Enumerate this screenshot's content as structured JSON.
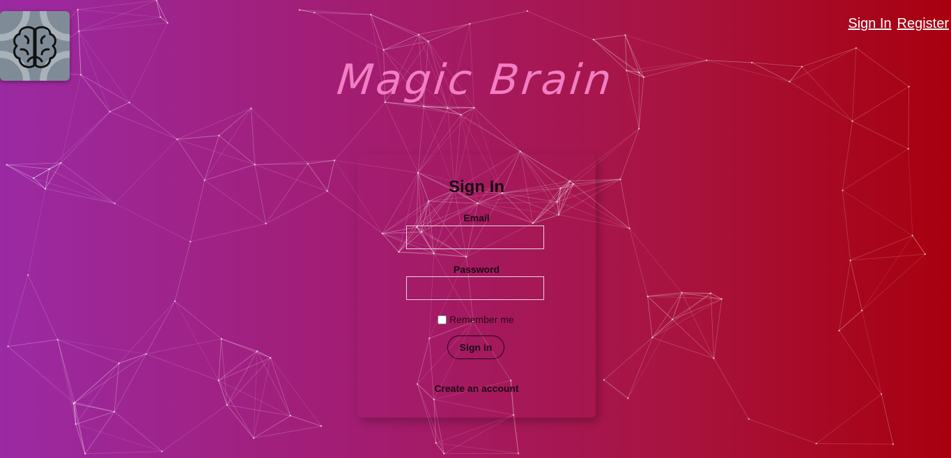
{
  "nav": {
    "sign_in": "Sign In",
    "register": "Register"
  },
  "app": {
    "title": "Magic Brain",
    "logo_icon": "brain-icon"
  },
  "form": {
    "title": "Sign In",
    "email_label": "Email",
    "email_value": "",
    "password_label": "Password",
    "password_value": "",
    "remember_label": "Remember me",
    "remember_checked": false,
    "submit_label": "Sign in",
    "create_account": "Create an account"
  },
  "colors": {
    "gradient_left": "#9b2aa3",
    "gradient_right": "#a8000e",
    "title": "#f17ec3",
    "logo_bg": "#7f8c97"
  }
}
